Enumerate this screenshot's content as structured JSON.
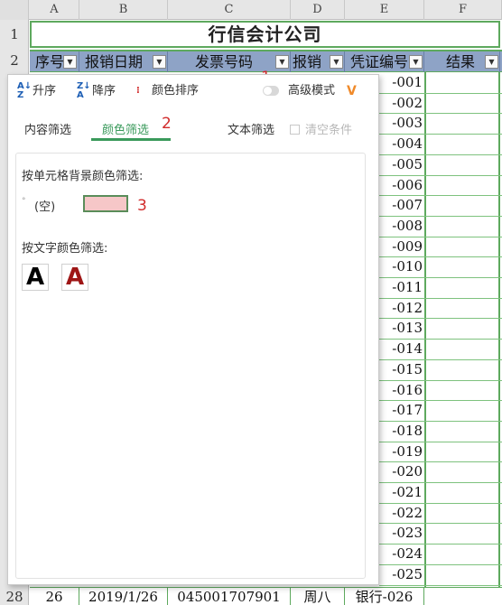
{
  "columns": [
    "A",
    "B",
    "C",
    "D",
    "E",
    "F"
  ],
  "rows": {
    "first": [
      "1",
      "2"
    ],
    "last": "28"
  },
  "title": "行信会计公司",
  "headers": {
    "seq": "序号",
    "date": "报销日期",
    "invoice": "发票号码",
    "person": "报销",
    "voucher": "凭证编号",
    "result": "结果"
  },
  "annotations": [
    "1",
    "2",
    "3"
  ],
  "voucher_suffixes": [
    "-001",
    "-002",
    "-003",
    "-004",
    "-005",
    "-006",
    "-007",
    "-008",
    "-009",
    "-010",
    "-011",
    "-012",
    "-013",
    "-014",
    "-015",
    "-016",
    "-017",
    "-018",
    "-019",
    "-020",
    "-021",
    "-022",
    "-023",
    "-024",
    "-025"
  ],
  "bottom_row": {
    "seq": "26",
    "date": "2019/1/26",
    "invoice": "045001707901",
    "person": "周八",
    "voucher": "银行-026"
  },
  "filter_panel": {
    "toolbar": {
      "asc": "升序",
      "desc": "降序",
      "color_sort": "颜色排序",
      "advanced": "高级模式"
    },
    "tabs": {
      "content": "内容筛选",
      "color": "颜色筛选",
      "text": "文本筛选",
      "clear": "清空条件"
    },
    "bg_section_label": "按单元格背景颜色筛选:",
    "empty_option": "(空)",
    "font_section_label": "按文字颜色筛选:",
    "font_glyph_black": "A",
    "font_glyph_red": "A"
  },
  "colors": {
    "accent_green": "#3a9a5b",
    "swatch_pink": "#f6c7c8",
    "annotation_red": "#d12b2b",
    "header_blue": "#8ea3c6",
    "advanced_icon": "#f08a2a"
  }
}
